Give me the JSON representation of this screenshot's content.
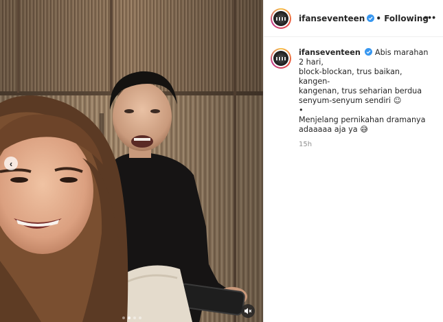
{
  "post": {
    "media": {
      "prev_glyph": "‹",
      "mute_icon": "speaker-muted-icon",
      "carousel": {
        "count": 4,
        "active_index": 1
      }
    },
    "header": {
      "username": "ifanseventeen",
      "separator": "•",
      "follow_status": "Following",
      "more_glyph": "•••"
    },
    "caption": {
      "username": "ifanseventeen",
      "lines": [
        "Abis marahan 2 hari,",
        "block-blockan, trus baikan, kangen-",
        "kangenan, trus seharian berdua",
        "senyum-senyum sendiri"
      ],
      "emoji_1": "☺",
      "bullet": "•",
      "line_2a": "Menjelang pernikahan dramanya",
      "line_2b": "adaaaaa aja ya",
      "emoji_2": "😅",
      "timestamp": "15h"
    },
    "colors": {
      "verified_blue": "#3897f0",
      "muted_text": "#8e8e8e",
      "text": "#262626"
    }
  }
}
